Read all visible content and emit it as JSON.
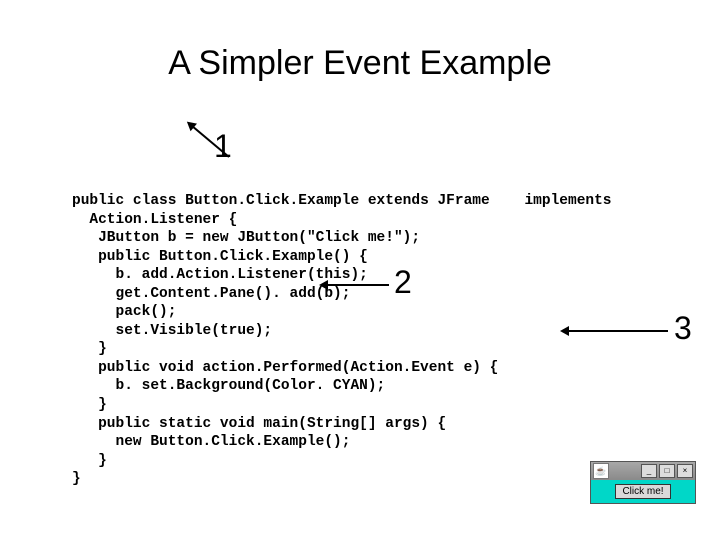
{
  "title": "A Simpler Event Example",
  "annotations": {
    "n1": "1",
    "n2": "2",
    "n3": "3"
  },
  "code": {
    "l01a": "public class ",
    "l01b": "Button.Click.Example",
    "l01c": " extends JFrame    implements",
    "l02": "  Action.Listener {",
    "l03": "   JButton b = new JButton(\"Click me!\");",
    "l04": "   public Button.Click.Example() {",
    "l05": "     b. add.Action.Listener(this);",
    "l06": "     get.Content.Pane(). add(b);",
    "l07": "     pack();",
    "l08": "     set.Visible(true);",
    "l09": "   }",
    "l10": "   public void action.Performed(Action.Event e) {",
    "l11": "     b. set.Background(Color. CYAN);",
    "l12": "   }",
    "l13": "   public static void main(String[] args) {",
    "l14": "     new Button.Click.Example();",
    "l15": "   }",
    "l16": "}"
  },
  "window": {
    "icon_glyph": "☕",
    "minimize": "_",
    "maximize": "□",
    "close": "×",
    "button_label": "Click me!"
  }
}
